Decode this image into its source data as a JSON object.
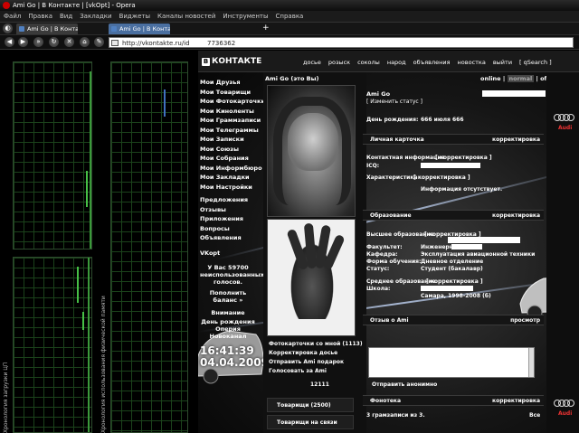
{
  "window": {
    "title": "Ami Go | В Контакте | [vkOpt] - Opera"
  },
  "menu": [
    "Файл",
    "Правка",
    "Вид",
    "Закладки",
    "Виджеты",
    "Каналы новостей",
    "Инструменты",
    "Справка"
  ],
  "tabs": [
    {
      "label": "Ami Go | В Контакте |"
    },
    {
      "label": "Ami Go | В Контакте |"
    }
  ],
  "newtab_label": "+",
  "address": {
    "url": "http://vkontakte.ru/id",
    "url_suffix": "7736362"
  },
  "gadgets": {
    "cpu_label": "Хронология загрузки ЦП",
    "memory_label": "Хронология использования физической памяти"
  },
  "site": {
    "logo_letter": "В",
    "logo_text": "КОНТАКТЕ",
    "nav": [
      "досье",
      "розыск",
      "соколы",
      "народ",
      "объявления",
      "новостка",
      "выйти",
      "[ qSearch ]"
    ],
    "left_menu": [
      "Мои Друзья",
      "Мои Товарищи",
      "Мои Фотокарточки",
      "Мои Киноленты",
      "Мои Граммзаписи",
      "Мои Телеграммы",
      "Мои Записки",
      "Мои Союзы",
      "Мои Собрания",
      "Мои Информбюро",
      "Мои Закладки",
      "Мои Настройки",
      "Предложения",
      "Отзывы",
      "Приложения",
      "Вопросы",
      "Объявления",
      "VKopt"
    ],
    "votes": "У Вас 59700 неиспользованных голосов.",
    "top_up": "Пополнить баланс »",
    "attention_title": "Внимание",
    "attention_lines": [
      "День рождения",
      "Оперия",
      "Новоканал"
    ],
    "clock_time": "16:41:39",
    "clock_date": "04.04.2009",
    "profile_title": "Ami Go (это Вы)",
    "links": [
      "Фотокарточки со мной (1113)",
      "Корректировка досье",
      "Отправить Ami подарок",
      "Голосовать за Ami"
    ],
    "vote_count": "12111",
    "friends": "Товарищи (2500)",
    "friends_online": "Товарищи на связи",
    "online": {
      "left": "online",
      "mid": "normal",
      "right": "offline"
    },
    "name": "Ami Go",
    "status": "[ Изменить статус ]",
    "birthday_label": "День рождения:",
    "birthday_value": "666 июля 666",
    "card_title": "Личная карточка",
    "edit": "корректировка",
    "contact_info": "Контактная информация",
    "contact_edit": "[ корректировка ]",
    "icq_label": "ICQ:",
    "traits_label": "Характеристика",
    "traits_edit": "[ корректировка ]",
    "no_info": "Информация отсутствует.",
    "education_title": "Образование",
    "higher_edu": "Высшее образование",
    "higher_edit": "[ корректировка ]",
    "faculty_label": "Факультет:",
    "faculty_value": "Инженерный",
    "chair_label": "Кафедра:",
    "chair_value": "Эксплуатация авиационной техники",
    "form_label": "Форма обучения:",
    "form_value": "Дневное отделение",
    "status_label": "Статус:",
    "status_value": "Студент (бакалавр)",
    "secondary_edu": "Среднее образование",
    "secondary_edit": "[ корректировка ]",
    "school_label": "Школа:",
    "school_value": "Самара, 1998-2008 (б)",
    "reviews_title": "Отзыв о Ami",
    "reviews_action": "просмотр",
    "send_anon": "Отправить анонимно",
    "phonoteca_title": "Фонотека",
    "tracks": "3 грамзаписи из 3.",
    "tracks_all": "Все",
    "audi_text": "Audi"
  }
}
